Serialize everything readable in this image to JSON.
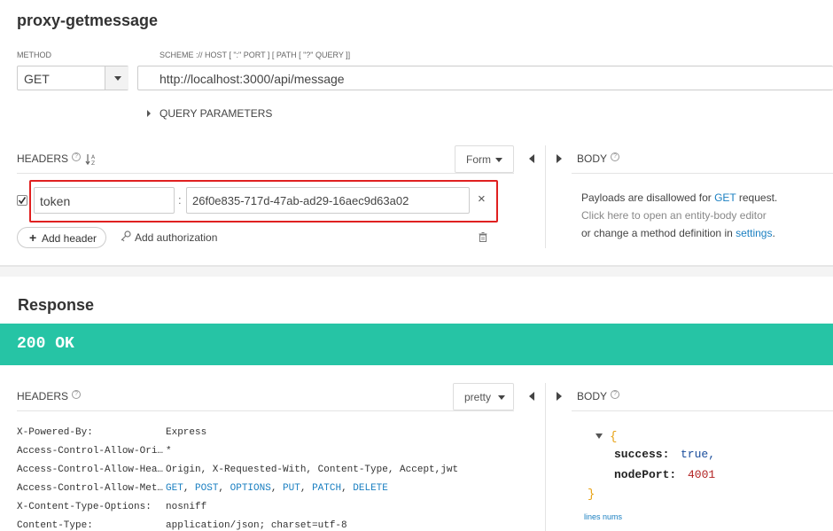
{
  "request": {
    "title": "proxy-getmessage",
    "method_label": "METHOD",
    "method_value": "GET",
    "scheme_label": "SCHEME :// HOST [ \":\" PORT ] [ PATH [ \"?\" QUERY ]]",
    "url_value": "http://localhost:3000/api/message",
    "query_params_label": "QUERY PARAMETERS",
    "headers_label": "HEADERS",
    "form_button": "Form",
    "body_label": "BODY",
    "header_row": {
      "name": "token",
      "separator": ":",
      "value": "26f0e835-717d-47ab-ad29-16aec9d63a02",
      "remove_glyph": "×"
    },
    "add_header_button": "Add header",
    "add_authorization": "Add authorization",
    "body_note": {
      "line1_a": "Payloads are disallowed for ",
      "line1_link": "GET",
      "line1_b": " request.",
      "line2": "Click here to open an entity-body editor",
      "line3_a": "or change a method definition in ",
      "line3_link": "settings",
      "line3_b": "."
    }
  },
  "response": {
    "title": "Response",
    "status": "200 OK",
    "status_color": "#26c4a5",
    "headers_label": "HEADERS",
    "pretty_button": "pretty",
    "body_label": "BODY",
    "headers": [
      {
        "key": "X-Powered-By:",
        "value": "Express"
      },
      {
        "key": "Access-Control-Allow-Ori…",
        "value": "*"
      },
      {
        "key": "Access-Control-Allow-Hea…",
        "value": "Origin, X-Requested-With, Content-Type, Accept,jwt"
      },
      {
        "key": "Access-Control-Allow-Met…",
        "value": "GET, POST, OPTIONS, PUT, PATCH, DELETE"
      },
      {
        "key": "X-Content-Type-Options:",
        "value": "nosniff"
      },
      {
        "key": "Content-Type:",
        "value": "application/json; charset=utf-8"
      }
    ],
    "methods": [
      "GET",
      "POST",
      "OPTIONS",
      "PUT",
      "PATCH",
      "DELETE"
    ],
    "body_json": {
      "open": "{",
      "k1": "success:",
      "v1": "true,",
      "k2": "nodePort:",
      "v2": "4001",
      "close": "}"
    },
    "lines_nums": "lines nums"
  },
  "colors": {
    "highlight_box": "#e02020",
    "link": "#1a7fc1",
    "json_number": "#b22222",
    "json_bool": "#1a4d9c"
  }
}
